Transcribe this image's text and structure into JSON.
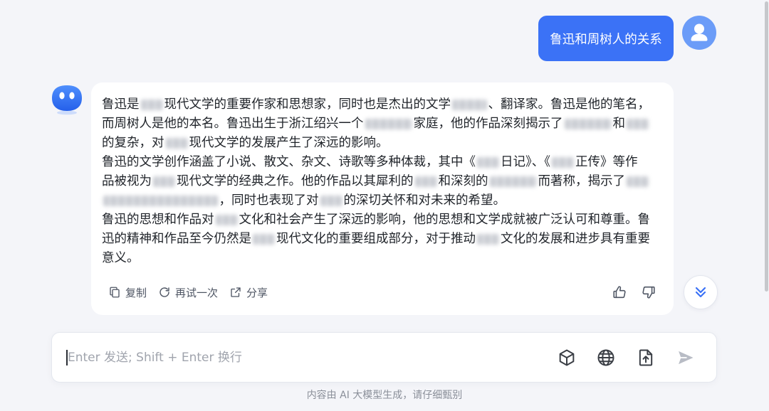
{
  "conversation": {
    "user_message": {
      "text": "鲁迅和周树人的关系"
    },
    "assistant_reply": {
      "lines": [
        [
          "鲁迅是",
          "现代文学的重要作家和思想家，同时也是杰出的文学",
          "、翻译家。鲁迅是他的笔名，"
        ],
        [
          "而周树人是他的本名。鲁迅出生于浙江绍兴一个",
          "家庭，他的作品深刻揭示了",
          "和"
        ],
        [
          "的复杂，对",
          "现代文学的发展产生了深远的影响。"
        ],
        [
          "鲁迅的文学创作涵盖了小说、散文、杂文、诗歌等多种体裁，其中《",
          "日记》、《",
          "正传》等作"
        ],
        [
          "品被视为",
          "现代文学的经典之作。他的作品以其犀利的",
          "和深刻的",
          "而著称，揭示了"
        ],
        [
          "，同时也表现了对",
          "的深切关怀和对未来的希望。"
        ],
        [
          "鲁迅的思想和作品对",
          "文化和社会产生了深远的影响，他的思想和文学成就被广泛认可和尊重。鲁"
        ],
        [
          "迅的精神和作品至今仍然是",
          "现代文化的重要组成部分，对于推动",
          "文化的发展和进步具有重要"
        ],
        [
          "意义。"
        ]
      ]
    }
  },
  "reply_actions": {
    "copy_label": "复制",
    "retry_label": "再试一次",
    "share_label": "分享"
  },
  "composer": {
    "placeholder": "Enter 发送; Shift + Enter 换行"
  },
  "footer": {
    "disclaimer": "内容由 AI 大模型生成，请仔细甄别"
  },
  "icons": {
    "user_avatar": "user-avatar-icon",
    "assistant_avatar": "assistant-avatar-icon",
    "copy": "copy-icon",
    "retry": "refresh-icon",
    "share": "share-icon",
    "like": "thumbs-up-icon",
    "dislike": "thumbs-down-icon",
    "scroll_down": "double-chevron-down-icon",
    "cube": "cube-icon",
    "globe": "globe-icon",
    "upload": "file-upload-icon",
    "send": "send-icon"
  },
  "colors": {
    "accent": "#3b72f6",
    "user_avatar": "#6b9cf8",
    "background": "#f4f5f9",
    "reply_text": "#1f2329",
    "muted_text": "#8a8f99",
    "send_disabled": "#b8bcc5"
  }
}
